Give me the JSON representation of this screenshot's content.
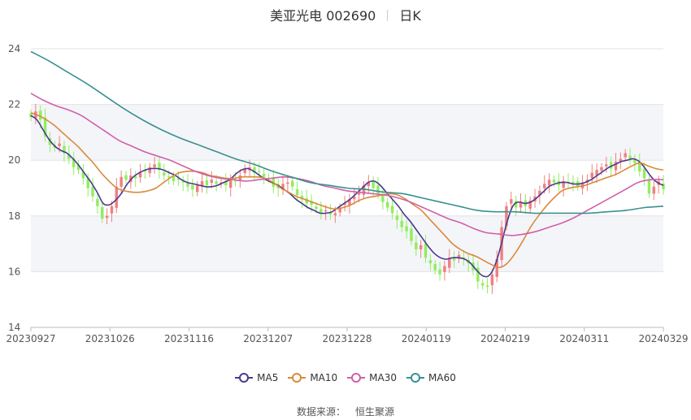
{
  "header": {
    "stock": "美亚光电 002690",
    "period": "日K"
  },
  "source": {
    "label": "数据来源：",
    "value": "恒生聚源"
  },
  "chart_data": {
    "type": "candlestick",
    "ylim": [
      14,
      24
    ],
    "yticks": [
      14,
      16,
      18,
      20,
      22,
      24
    ],
    "grid": true,
    "legend_position": "bottom",
    "up_color": "#f08080",
    "down_color": "#90ee60",
    "xticks": [
      {
        "label": "20230927",
        "index": 0
      },
      {
        "label": "20231026",
        "index": 20
      },
      {
        "label": "20231116",
        "index": 40
      },
      {
        "label": "20231207",
        "index": 60
      },
      {
        "label": "20231228",
        "index": 80
      },
      {
        "label": "20240119",
        "index": 100
      },
      {
        "label": "20240219",
        "index": 120
      },
      {
        "label": "20240311",
        "index": 140
      },
      {
        "label": "20240329",
        "index": 160
      }
    ],
    "close": [
      21.55,
      21.75,
      21.45,
      20.85,
      20.55,
      20.45,
      20.6,
      20.25,
      20.05,
      19.75,
      19.65,
      19.35,
      19.0,
      18.7,
      18.35,
      17.9,
      18.0,
      18.35,
      19.05,
      19.4,
      19.3,
      19.45,
      19.35,
      19.55,
      19.6,
      19.75,
      19.85,
      19.65,
      19.45,
      19.4,
      19.25,
      19.3,
      19.2,
      19.05,
      18.95,
      19.1,
      19.25,
      19.1,
      19.3,
      19.15,
      19.2,
      19.1,
      19.3,
      19.25,
      19.45,
      19.7,
      19.75,
      19.55,
      19.6,
      19.4,
      19.35,
      19.05,
      19.0,
      19.15,
      19.2,
      19.05,
      18.75,
      18.6,
      18.45,
      18.4,
      18.25,
      18.1,
      18.2,
      18.05,
      18.1,
      18.3,
      18.45,
      18.6,
      18.7,
      18.85,
      19.1,
      19.2,
      19.0,
      18.8,
      18.5,
      18.3,
      18.1,
      17.85,
      17.6,
      17.45,
      17.1,
      16.8,
      16.95,
      16.5,
      16.3,
      16.05,
      15.9,
      16.2,
      16.5,
      16.4,
      16.6,
      16.45,
      16.3,
      16.05,
      15.65,
      15.5,
      15.45,
      15.9,
      16.45,
      17.6,
      18.35,
      18.6,
      18.3,
      18.5,
      18.35,
      18.55,
      18.7,
      18.9,
      19.15,
      19.3,
      19.2,
      19.1,
      19.25,
      19.2,
      19.15,
      19.05,
      19.2,
      19.3,
      19.55,
      19.65,
      19.75,
      19.85,
      19.7,
      19.95,
      20.05,
      20.25,
      20.05,
      19.9,
      19.6,
      19.35,
      18.8,
      19.05,
      19.25,
      18.95
    ],
    "series": [
      {
        "name": "MA5",
        "color": "#4a3a8f",
        "values": [
          21.6,
          21.45,
          21.1,
          20.75,
          20.5,
          20.35,
          20.25,
          20.05,
          19.8,
          19.5,
          19.2,
          18.85,
          18.45,
          18.4,
          18.55,
          18.8,
          19.15,
          19.4,
          19.55,
          19.65,
          19.7,
          19.7,
          19.65,
          19.55,
          19.45,
          19.3,
          19.2,
          19.15,
          19.1,
          19.05,
          19.05,
          19.1,
          19.2,
          19.3,
          19.5,
          19.65,
          19.7,
          19.6,
          19.45,
          19.3,
          19.2,
          19.1,
          18.95,
          18.8,
          18.6,
          18.45,
          18.3,
          18.2,
          18.1,
          18.1,
          18.15,
          18.3,
          18.45,
          18.6,
          18.8,
          19.0,
          19.2,
          19.25,
          19.1,
          18.85,
          18.6,
          18.35,
          18.05,
          17.8,
          17.5,
          17.2,
          16.9,
          16.65,
          16.5,
          16.45,
          16.5,
          16.5,
          16.45,
          16.3,
          16.05,
          15.85,
          15.85,
          16.2,
          16.9,
          17.75,
          18.35,
          18.5,
          18.45,
          18.5,
          18.65,
          18.85,
          19.05,
          19.15,
          19.2,
          19.2,
          19.15,
          19.15,
          19.2,
          19.3,
          19.45,
          19.6,
          19.75,
          19.85,
          19.95,
          20.0,
          20.05,
          19.95,
          19.7,
          19.4,
          19.2,
          19.1
        ]
      },
      {
        "name": "MA10",
        "color": "#d98a3a",
        "values": [
          21.7,
          21.6,
          21.45,
          21.25,
          21.0,
          20.75,
          20.5,
          20.2,
          19.9,
          19.55,
          19.25,
          19.0,
          18.9,
          18.85,
          18.85,
          18.9,
          19.0,
          19.2,
          19.4,
          19.55,
          19.6,
          19.6,
          19.55,
          19.45,
          19.4,
          19.35,
          19.35,
          19.4,
          19.4,
          19.4,
          19.35,
          19.2,
          19.0,
          18.85,
          18.7,
          18.6,
          18.5,
          18.4,
          18.3,
          18.25,
          18.3,
          18.4,
          18.55,
          18.65,
          18.7,
          18.75,
          18.8,
          18.75,
          18.6,
          18.4,
          18.2,
          17.9,
          17.6,
          17.3,
          17.0,
          16.8,
          16.65,
          16.55,
          16.4,
          16.25,
          16.15,
          16.3,
          16.65,
          17.1,
          17.6,
          18.0,
          18.35,
          18.65,
          18.9,
          19.0,
          19.05,
          19.1,
          19.2,
          19.3,
          19.4,
          19.5,
          19.65,
          19.8,
          19.9,
          19.8,
          19.7,
          19.65
        ]
      },
      {
        "name": "MA30",
        "color": "#d060a8",
        "values": [
          22.4,
          22.15,
          21.95,
          21.8,
          21.6,
          21.3,
          21.0,
          20.7,
          20.5,
          20.3,
          20.15,
          20.0,
          19.8,
          19.6,
          19.45,
          19.35,
          19.3,
          19.25,
          19.3,
          19.35,
          19.4,
          19.35,
          19.25,
          19.1,
          19.0,
          18.9,
          18.85,
          18.8,
          18.75,
          18.65,
          18.5,
          18.3,
          18.1,
          17.9,
          17.75,
          17.55,
          17.4,
          17.35,
          17.3,
          17.35,
          17.45,
          17.6,
          17.75,
          17.95,
          18.2,
          18.45,
          18.7,
          18.95,
          19.2,
          19.3,
          19.3
        ]
      },
      {
        "name": "MA60",
        "color": "#3a9090",
        "values": [
          23.9,
          23.55,
          23.15,
          22.75,
          22.3,
          21.85,
          21.45,
          21.1,
          20.8,
          20.55,
          20.3,
          20.05,
          19.85,
          19.6,
          19.4,
          19.2,
          19.1,
          19.0,
          18.95,
          18.85,
          18.8,
          18.65,
          18.5,
          18.35,
          18.2,
          18.15,
          18.15,
          18.1,
          18.1,
          18.1,
          18.1,
          18.15,
          18.2,
          18.3,
          18.35
        ]
      }
    ]
  }
}
